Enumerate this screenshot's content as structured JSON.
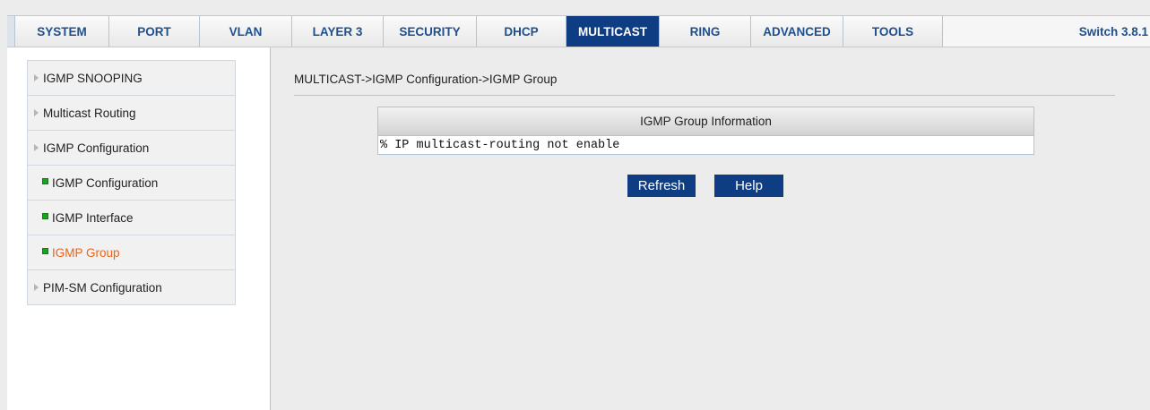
{
  "nav": {
    "tabs": [
      "SYSTEM",
      "PORT",
      "VLAN",
      "LAYER 3",
      "SECURITY",
      "DHCP",
      "MULTICAST",
      "RING",
      "ADVANCED",
      "TOOLS"
    ],
    "active_tab": "MULTICAST",
    "brand": "Switch 3.8.1"
  },
  "sidebar": {
    "items": [
      {
        "label": "IGMP SNOOPING",
        "kind": "group",
        "icon": "triangle-right-icon"
      },
      {
        "label": "Multicast Routing",
        "kind": "group",
        "icon": "triangle-right-icon"
      },
      {
        "label": "IGMP Configuration",
        "kind": "group",
        "icon": "triangle-right-icon"
      },
      {
        "label": "IGMP Configuration",
        "kind": "sub",
        "icon": "green-square-icon"
      },
      {
        "label": "IGMP Interface",
        "kind": "sub",
        "icon": "green-square-icon"
      },
      {
        "label": "IGMP Group",
        "kind": "sub",
        "icon": "green-square-icon",
        "selected": true
      },
      {
        "label": "PIM-SM Configuration",
        "kind": "group",
        "icon": "triangle-right-icon"
      }
    ]
  },
  "main": {
    "breadcrumb": "MULTICAST->IGMP Configuration->IGMP Group",
    "table": {
      "header": "IGMP Group Information",
      "message": "% IP multicast-routing not enable"
    },
    "buttons": {
      "refresh": "Refresh",
      "help": "Help"
    }
  },
  "colors": {
    "nav_active": "#0e3d84",
    "nav_text": "#1f4f8c",
    "selected_item": "#e8631b",
    "bullet": "#18a51c"
  }
}
